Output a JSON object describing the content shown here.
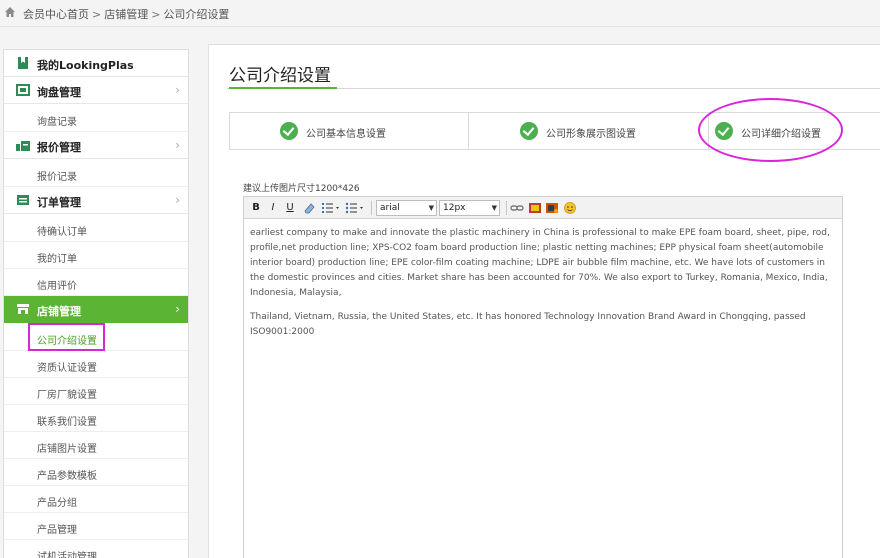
{
  "breadcrumb": {
    "items": [
      "会员中心首页",
      "店铺管理",
      "公司介绍设置"
    ],
    "separator": ">"
  },
  "sidebar": {
    "sections": [
      {
        "label": "我的LookingPlas",
        "icon": "bookmark-icon",
        "chevron": false,
        "items": []
      },
      {
        "label": "询盘管理",
        "icon": "inquiry-icon",
        "chevron": true,
        "items": [
          "询盘记录"
        ]
      },
      {
        "label": "报价管理",
        "icon": "quote-icon",
        "chevron": true,
        "items": [
          "报价记录"
        ]
      },
      {
        "label": "订单管理",
        "icon": "order-icon",
        "chevron": true,
        "items": [
          "待确认订单",
          "我的订单",
          "信用评价"
        ]
      },
      {
        "label": "店铺管理",
        "icon": "store-icon",
        "chevron": true,
        "active": true,
        "items": [
          "公司介绍设置",
          "资质认证设置",
          "厂房厂貌设置",
          "联系我们设置",
          "店铺图片设置",
          "产品参数模板",
          "产品分组",
          "产品管理",
          "试机活动管理"
        ]
      }
    ],
    "current_item": "公司介绍设置"
  },
  "page": {
    "title": "公司介绍设置",
    "steps": [
      "公司基本信息设置",
      "公司形象展示图设置",
      "公司详细介绍设置"
    ],
    "image_hint": "建议上传图片尺寸1200*426"
  },
  "editor": {
    "toolbar": {
      "bold": "B",
      "italic": "I",
      "underline": "U",
      "font_family": "arial",
      "font_size": "12px"
    },
    "content": {
      "paragraph1": "earliest company to make and innovate the plastic machinery in China is professional to make EPE foam board, sheet, pipe, rod, profile,net production line; XPS-CO2 foam board production line; plastic netting machines; EPP physical foam sheet(automobile interior board) production line; EPE color-film coating machine; LDPE air bubble film machine, etc. We have lots of customers in the domestic provinces and cities. Market share has been accounted for 70%. We also export to Turkey, Romania, Mexico, India, Indonesia, Malaysia,",
      "paragraph2": "Thailand, Vietnam, Russia, the United States, etc. It has honored Technology Innovation Brand Award in Chongqing, passed ISO9001:2000"
    }
  },
  "colors": {
    "accent_green": "#5bb434",
    "check_green": "#4caf50",
    "highlight_magenta": "#d925d9"
  }
}
